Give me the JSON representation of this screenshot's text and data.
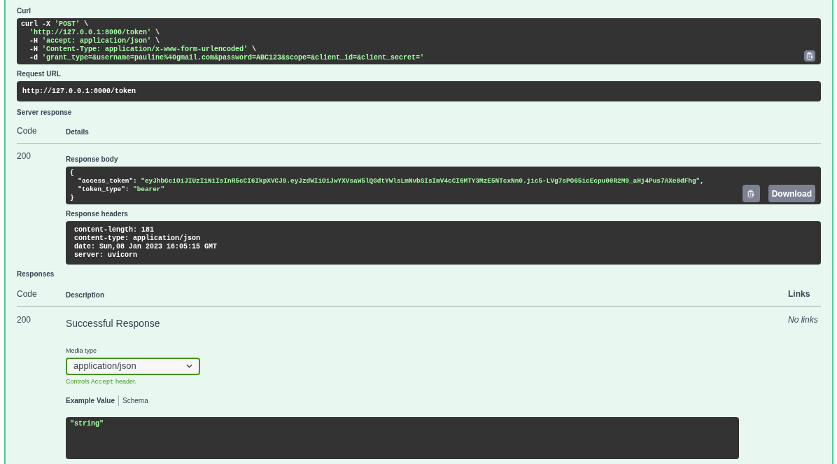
{
  "curl": {
    "label": "Curl",
    "lines": [
      [
        {
          "t": "curl -X ",
          "kind": "plain"
        },
        {
          "t": "'POST'",
          "kind": "string"
        },
        {
          "t": " \\",
          "kind": "plain"
        }
      ],
      [
        {
          "t": "  'http://127.0.0.1:8000/token'",
          "kind": "string"
        },
        {
          "t": " \\",
          "kind": "plain"
        }
      ],
      [
        {
          "t": "  -H ",
          "kind": "plain"
        },
        {
          "t": "'accept: application/json'",
          "kind": "string"
        },
        {
          "t": " \\",
          "kind": "plain"
        }
      ],
      [
        {
          "t": "  -H ",
          "kind": "plain"
        },
        {
          "t": "'Content-Type: application/x-www-form-urlencoded'",
          "kind": "string"
        },
        {
          "t": " \\",
          "kind": "plain"
        }
      ],
      [
        {
          "t": "  -d ",
          "kind": "plain"
        },
        {
          "t": "'grant_type=&username=pauline%40gmail.com&password=ABC123&scope=&client_id=&client_secret='",
          "kind": "string"
        }
      ]
    ]
  },
  "request_url": {
    "label": "Request URL",
    "value": "http://127.0.0.1:8000/token"
  },
  "server_response": {
    "label": "Server response",
    "columns": [
      "Code",
      "Details"
    ],
    "code": "200",
    "body_label": "Response body",
    "body_lines": [
      [
        {
          "t": "{",
          "kind": "plain"
        }
      ],
      [
        {
          "t": "  \"access_token\": ",
          "kind": "plain"
        },
        {
          "t": "\"eyJhbGciOiJIUzI1NiIsInR5cCI6IkpXVCJ9.eyJzdWIiOiJwYXVsaW5lQGdtYWlsLmNvbSIsImV4cCI6MTY3MzE5NTcxNn0.jic5-LVg7sPO65icEcpu00R2M9_aHj4Pus7AXe0dFhg\"",
          "kind": "string"
        },
        {
          "t": ",",
          "kind": "plain"
        }
      ],
      [
        {
          "t": "  \"token_type\": ",
          "kind": "plain"
        },
        {
          "t": "\"bearer\"",
          "kind": "string"
        }
      ],
      [
        {
          "t": "}",
          "kind": "plain"
        }
      ]
    ],
    "download_label": "Download",
    "headers_label": "Response headers",
    "header_lines": [
      [
        {
          "t": " content-length: 181",
          "kind": "plain"
        }
      ],
      [
        {
          "t": " content-type: application/json",
          "kind": "plain"
        }
      ],
      [
        {
          "t": " date: Sun,08 Jan 2023 16:05:15 GMT",
          "kind": "plain"
        }
      ],
      [
        {
          "t": " server: uvicorn",
          "kind": "plain"
        }
      ]
    ]
  },
  "responses": {
    "label": "Responses",
    "columns": [
      "Code",
      "Description",
      "Links"
    ],
    "rows": [
      {
        "code": "200",
        "description": "Successful Response",
        "media_type_label": "Media type",
        "media_type": "application/json",
        "note": {
          "before": "Controls",
          "code": "Accept",
          "after": "header."
        },
        "tabs": [
          {
            "label": "Example Value",
            "selected": true
          },
          {
            "label": "Schema",
            "selected": false
          }
        ],
        "example_lines": [
          [
            {
              "t": "\"string\"",
              "kind": "string"
            }
          ]
        ],
        "links": "No links"
      }
    ]
  }
}
